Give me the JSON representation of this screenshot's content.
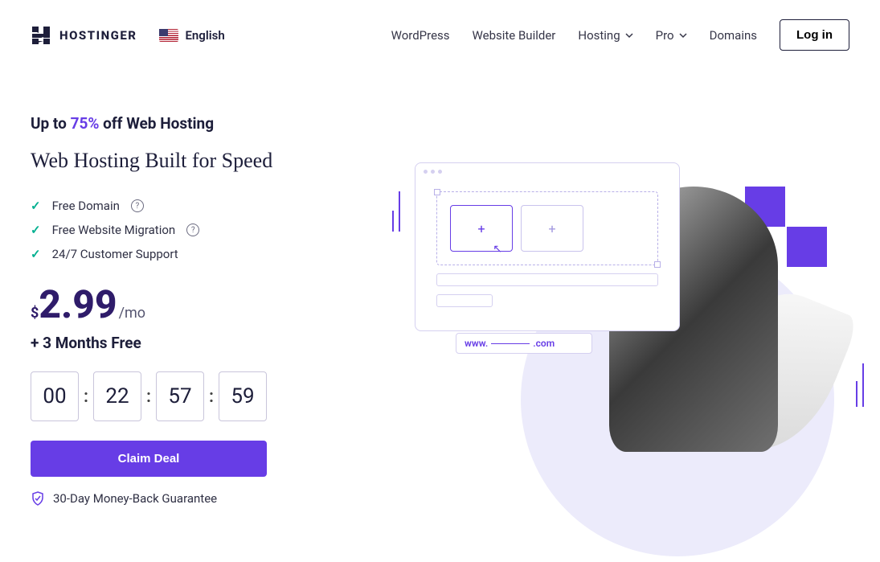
{
  "brand": "HOSTINGER",
  "language": "English",
  "nav": {
    "wordpress": "WordPress",
    "builder": "Website Builder",
    "hosting": "Hosting",
    "pro": "Pro",
    "domains": "Domains",
    "login": "Log in"
  },
  "hero": {
    "offer_prefix": "Up to ",
    "offer_percent": "75%",
    "offer_suffix": " off Web Hosting",
    "headline": "Web Hosting Built for Speed",
    "features": {
      "0": "Free Domain",
      "1": "Free Website Migration",
      "2": "24/7 Customer Support"
    },
    "currency": "$",
    "price": "2.99",
    "period": "/mo",
    "bonus": "+ 3 Months Free",
    "timer": {
      "days": "00",
      "hours": "22",
      "minutes": "57",
      "seconds": "59"
    },
    "cta": "Claim Deal",
    "guarantee": "30-Day Money-Back Guarantee"
  },
  "mock": {
    "url_prefix": "www.",
    "url_suffix": ".com"
  }
}
